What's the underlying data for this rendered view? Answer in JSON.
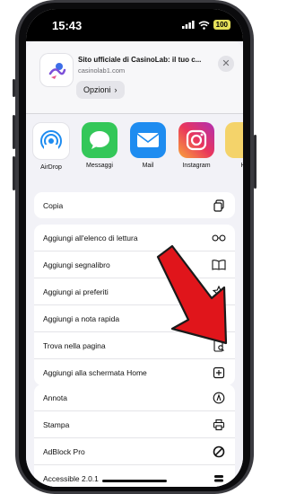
{
  "status_bar": {
    "time": "15:43",
    "battery": "100"
  },
  "header": {
    "title": "Sito ufficiale di CasinoLab: il tuo c...",
    "url": "casinolab1.com",
    "options_label": "Opzioni",
    "options_chevron": "›",
    "close_glyph": "✕"
  },
  "apps": [
    {
      "label": "AirDrop",
      "icon": "airdrop-icon"
    },
    {
      "label": "Messaggi",
      "icon": "messages-icon"
    },
    {
      "label": "Mail",
      "icon": "mail-icon"
    },
    {
      "label": "Instagram",
      "icon": "instagram-icon"
    },
    {
      "label": "H",
      "icon": "partial-app-icon"
    }
  ],
  "actions_copy": [
    {
      "label": "Copia",
      "icon": "copy-icon"
    }
  ],
  "actions_page": [
    {
      "label": "Aggiungi all'elenco di lettura",
      "icon": "glasses-icon"
    },
    {
      "label": "Aggiungi segnalibro",
      "icon": "book-icon"
    },
    {
      "label": "Aggiungi ai preferiti",
      "icon": "star-icon"
    },
    {
      "label": "Aggiungi a nota rapida",
      "icon": "quick-note-icon"
    },
    {
      "label": "Trova nella pagina",
      "icon": "find-in-page-icon"
    },
    {
      "label": "Aggiungi alla schermata Home",
      "icon": "add-square-icon"
    }
  ],
  "actions_more": [
    {
      "label": "Annota",
      "icon": "markup-icon"
    },
    {
      "label": "Stampa",
      "icon": "printer-icon"
    },
    {
      "label": "AdBlock Pro",
      "icon": "block-icon"
    },
    {
      "label": "Accessible 2.0.1",
      "icon": "stack-icon"
    }
  ],
  "colors": {
    "annotation_arrow": "#e0151b",
    "messages": "#34c759",
    "mail": "#1e8cf0",
    "battery": "#e5e05a"
  }
}
